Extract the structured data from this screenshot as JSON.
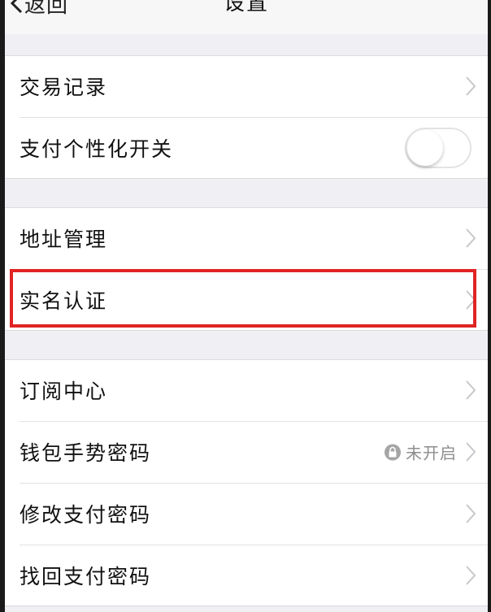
{
  "navbar": {
    "back_label": "返回",
    "title": "设置"
  },
  "groups": [
    {
      "items": [
        {
          "label": "交易记录",
          "accessory": "chevron"
        },
        {
          "label": "支付个性化开关",
          "accessory": "toggle",
          "toggle_on": false
        }
      ]
    },
    {
      "items": [
        {
          "label": "地址管理",
          "accessory": "chevron"
        },
        {
          "label": "实名认证",
          "accessory": "chevron",
          "highlighted": true
        }
      ]
    },
    {
      "items": [
        {
          "label": "订阅中心",
          "accessory": "chevron"
        },
        {
          "label": "钱包手势密码",
          "accessory": "chevron",
          "status": "未开启",
          "status_icon": "lock-icon"
        },
        {
          "label": "修改支付密码",
          "accessory": "chevron"
        },
        {
          "label": "找回支付密码",
          "accessory": "chevron"
        }
      ]
    }
  ],
  "colors": {
    "highlight": "#e02424",
    "background": "#efeff4",
    "chevron": "#c7c7cc"
  }
}
